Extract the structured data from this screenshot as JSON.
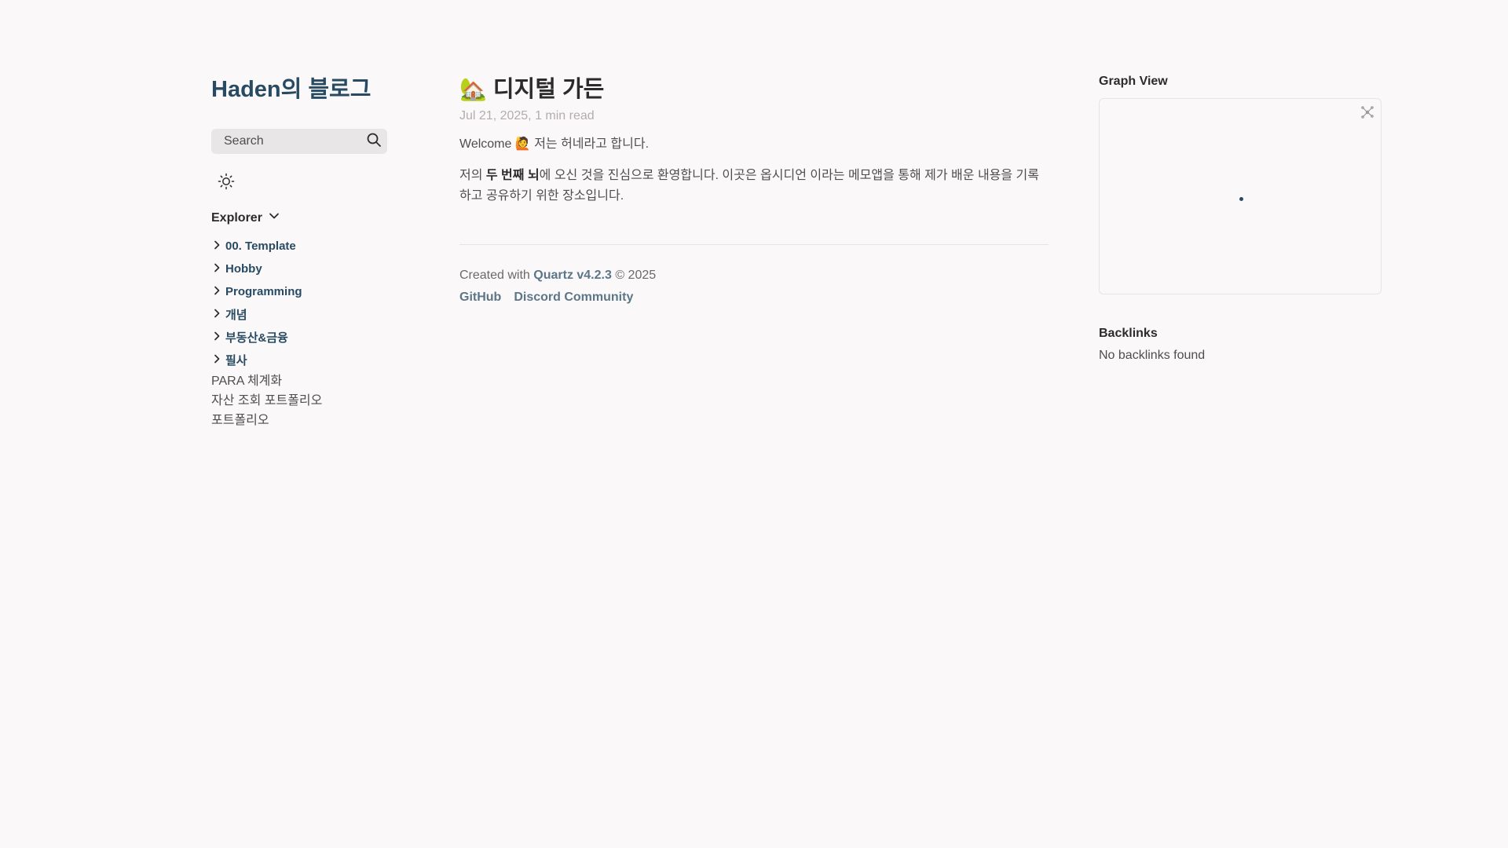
{
  "site": {
    "title": "Haden의 블로그"
  },
  "search": {
    "placeholder": "Search"
  },
  "explorer": {
    "label": "Explorer",
    "folders": [
      {
        "label": "00. Template"
      },
      {
        "label": "Hobby"
      },
      {
        "label": "Programming"
      },
      {
        "label": "개념"
      },
      {
        "label": "부동산&금융"
      },
      {
        "label": "필사"
      }
    ],
    "files": [
      {
        "label": "PARA 체계화"
      },
      {
        "label": "자산 조회 포트폴리오"
      },
      {
        "label": "포트폴리오"
      }
    ]
  },
  "article": {
    "emoji": "🏡",
    "title": "디지털 가든",
    "meta": "Jul 21, 2025,  1 min read",
    "p1": "Welcome 🙋 저는 허네라고 합니다.",
    "p2_prefix": "저의 ",
    "p2_bold": "두 번째 뇌",
    "p2_suffix": "에 오신 것을 진심으로 환영합니다. 이곳은 옵시디언 이라는 메모앱을 통해 제가 배운 내용을 기록하고 공유하기 위한 장소입니다."
  },
  "footer": {
    "created_prefix": "Created with ",
    "quartz": "Quartz v4.2.3",
    "copyright": " © 2025",
    "links": [
      {
        "label": "GitHub"
      },
      {
        "label": "Discord Community"
      }
    ]
  },
  "graph": {
    "title": "Graph View"
  },
  "backlinks": {
    "title": "Backlinks",
    "empty": "No backlinks found"
  },
  "colors": {
    "accent": "#284b63",
    "background": "#faf8f8",
    "text": "#4e4e4e",
    "muted": "#b3aeae"
  },
  "icons": [
    "search-icon",
    "sun-icon",
    "chevron-down-icon",
    "chevron-right-icon",
    "global-graph-icon"
  ]
}
